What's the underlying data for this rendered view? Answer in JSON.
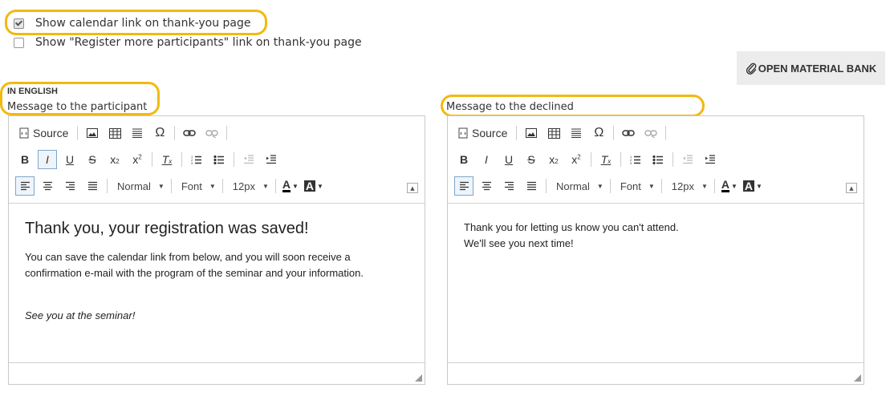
{
  "options": {
    "calendar_link_label": "Show calendar link on thank-you page",
    "calendar_link_checked": true,
    "register_more_label": "Show \"Register more participants\" link on thank-you page",
    "register_more_checked": false
  },
  "material_bank_button": "OPEN MATERIAL BANK",
  "language_heading": "IN ENGLISH",
  "highlight_color": "#f2b90f",
  "toolbar": {
    "source_label": "Source",
    "format_combo": "Normal",
    "font_combo": "Font",
    "size_combo": "12px",
    "bold": "B",
    "italic": "I",
    "underline": "U",
    "strike": "S",
    "omega": "Ω"
  },
  "editors": [
    {
      "label": "Message to the participant",
      "heading": "Thank you, your registration was saved!",
      "paragraphs": [
        "You can save the calendar link from below, and you will soon receive a confirmation e-mail with the program of the seminar and your information.",
        "See you at the seminar!"
      ]
    },
    {
      "label": "Message to the declined",
      "lines": [
        "Thank you for letting us know you can't attend.",
        "We'll see you next time!"
      ]
    }
  ]
}
